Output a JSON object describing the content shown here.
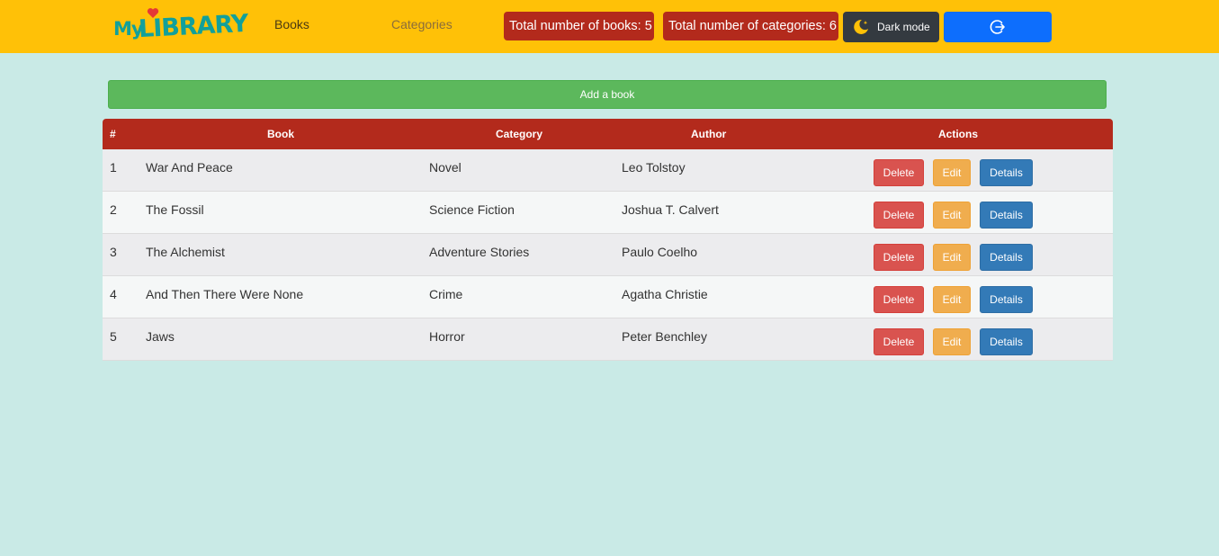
{
  "navbar": {
    "logo": "MyLIBRARY",
    "links": {
      "books": "Books",
      "categories": "Categories"
    },
    "stats": {
      "books": "Total number of books: 5",
      "categories": "Total number of categories: 6"
    },
    "dark_mode_label": "Dark mode",
    "logout_icon": "logout-icon"
  },
  "add_book_label": "Add a book",
  "table": {
    "headers": {
      "num": "#",
      "book": "Book",
      "category": "Category",
      "author": "Author",
      "actions": "Actions"
    },
    "rows": [
      {
        "num": "1",
        "book": "War And Peace",
        "category": "Novel",
        "author": "Leo Tolstoy"
      },
      {
        "num": "2",
        "book": "The Fossil",
        "category": "Science Fiction",
        "author": "Joshua T. Calvert"
      },
      {
        "num": "3",
        "book": "The Alchemist",
        "category": "Adventure Stories",
        "author": "Paulo Coelho"
      },
      {
        "num": "4",
        "book": "And Then There Were None",
        "category": "Crime",
        "author": "Agatha Christie"
      },
      {
        "num": "5",
        "book": "Jaws",
        "category": "Horror",
        "author": "Peter Benchley"
      }
    ],
    "action_labels": {
      "delete": "Delete",
      "edit": "Edit",
      "details": "Details"
    }
  },
  "colors": {
    "navbar": "#ffc107",
    "badge": "#b32a1c",
    "header": "#b32a1c",
    "add": "#5cb85c",
    "delete": "#d9534f",
    "edit": "#f0ad4e",
    "details": "#337ab7",
    "logout": "#0d6efd",
    "page_bg": "#c9eae6"
  }
}
